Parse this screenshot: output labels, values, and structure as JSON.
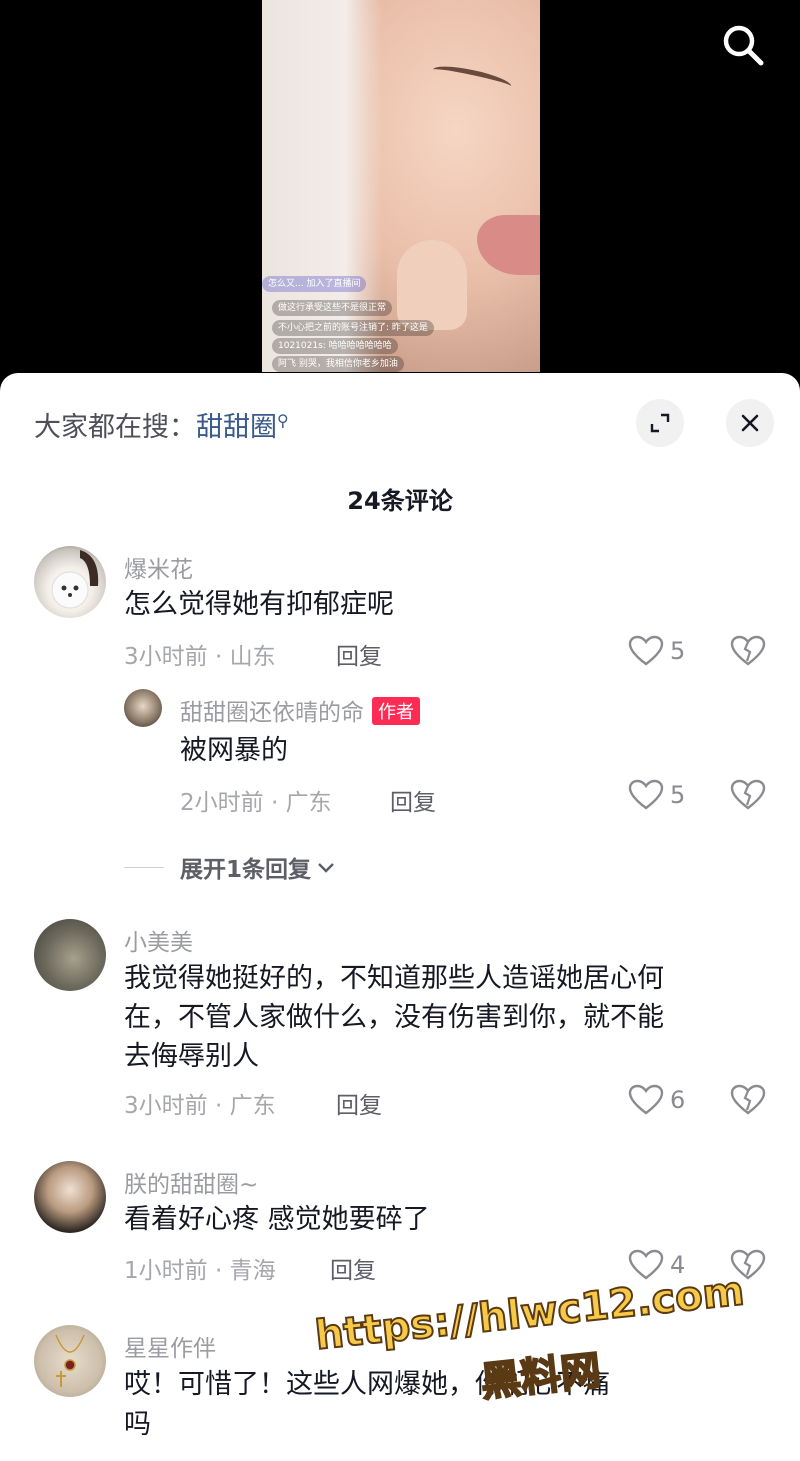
{
  "video": {
    "live_join": "怎么又... 加入了直播间",
    "live_messages": [
      {
        "user": "",
        "text": "做这行承受这些不是很正常"
      },
      {
        "user": "",
        "text": "不小心把之前的账号注销了: 昨了这是"
      },
      {
        "user": "1021021s:",
        "text": "哈哈哈哈哈哈哈"
      },
      {
        "user": "阿飞",
        "text": "别哭，我相信你老乡加油"
      }
    ]
  },
  "header": {
    "hot_search_prefix": "大家都在搜：",
    "hot_search_keyword": "甜甜圈",
    "comment_count": "24条评论"
  },
  "comments": [
    {
      "user": "爆米花",
      "text": "怎么觉得她有抑郁症呢",
      "meta": "3小时前 · 山东",
      "reply_label": "回复",
      "likes": "5",
      "replies": [
        {
          "user": "甜甜圈还依晴的命",
          "tag": "作者",
          "text": "被网暴的",
          "meta": "2小时前 · 广东",
          "reply_label": "回复",
          "likes": "5"
        }
      ],
      "expand_label": "展开1条回复"
    },
    {
      "user": "小美美",
      "text_lines": [
        "我觉得她挺好的，不知道那些人造谣她居心何",
        "在，不管人家做什么，没有伤害到你，就不能",
        "去侮辱别人"
      ],
      "meta": "3小时前 · 广东",
      "reply_label": "回复",
      "likes": "6"
    },
    {
      "user": "朕的甜甜圈~",
      "text": "看着好心疼 感觉她要碎了",
      "meta": "1小时前 · 青海",
      "reply_label": "回复",
      "likes": "4"
    },
    {
      "user": "星星作伴",
      "text_lines": [
        "哎！可惜了！这些人网爆她，你们心不痛",
        "吗"
      ]
    }
  ],
  "watermark": {
    "url": "https://hlwc12.com",
    "name": "黑料网"
  }
}
